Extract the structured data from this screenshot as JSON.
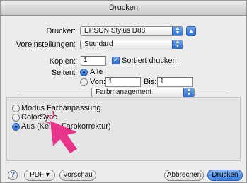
{
  "window": {
    "title": "Drucken"
  },
  "printer": {
    "label": "Drucker:",
    "value": "EPSON Stylus D88"
  },
  "presets": {
    "label": "Voreinstellungen:",
    "value": "Standard"
  },
  "copies": {
    "label": "Kopien:",
    "value": "1",
    "collate_label": "Sortiert drucken",
    "collate_checked": true
  },
  "pages": {
    "label": "Seiten:",
    "all_label": "Alle",
    "from_label": "Von:",
    "from_value": "1",
    "to_label": "Bis:",
    "to_value": "1",
    "selected": "Alle"
  },
  "section": {
    "value": "Farbmanagement"
  },
  "color_options": [
    {
      "label": "Modus Farbanpassung",
      "selected": false
    },
    {
      "label": "ColorSync",
      "selected": false
    },
    {
      "label": "Aus (Keine Farbkorrektur)",
      "selected": true
    }
  ],
  "footer": {
    "help_label": "?",
    "pdf_label": "PDF ▾",
    "preview_label": "Vorschau",
    "cancel_label": "Abbrechen",
    "print_label": "Drucken"
  },
  "colors": {
    "accent": "#2c6fd2",
    "cursor": "#e8348a"
  }
}
